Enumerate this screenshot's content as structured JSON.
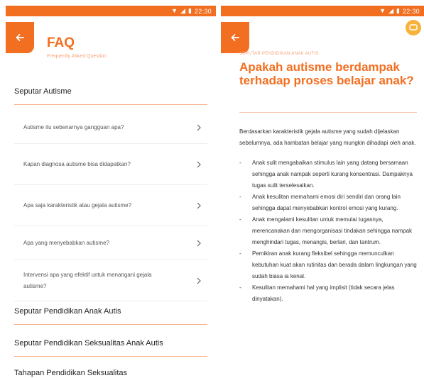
{
  "status": {
    "time": "22:30"
  },
  "faq": {
    "title": "FAQ",
    "subtitle": "Frequently Asked Question",
    "section1": "Seputar Autisme",
    "questions": [
      "Autisme itu sebenarnya gangguan apa?",
      "Kapan diagnosa autisme bisa didapatkan?",
      "Apa saja karakteristik atau gejala autisme?",
      "Apa yang menyebabkan autisme?",
      "Intervensi apa yang efektif untuk menangani gejala autisme?"
    ],
    "section2": "Seputar Pendidikan Anak Autis",
    "section3": "Seputar Pendidikan Seksualitas Anak Autis",
    "section4": "Tahapan Pendidikan Seksualitas"
  },
  "article": {
    "breadcrumb": "SEPUTAR PENDIDIKAN ANAK AUTIS",
    "title": "Apakah autisme berdampak terhadap proses belajar anak?",
    "intro": "Berdasarkan karakteristik gejala autisme yang sudah dijelaskan sebelumnya, ada hambatan belajar yang mungkin dihadapi oleh anak.",
    "bullets": [
      "Anak sulit mengabaikan stimulus lain yang datang bersamaan sehingga anak nampak seperti kurang konsentrasi. Dampaknya tugas sulit terselesaikan.",
      "Anak kesulitan memahami emosi diri sendiri dan orang lain sehingga dapat menyebabkan kontrol emosi yang kurang.",
      "Anak mengalami kesulitan untuk memulai tugasnya, merencanakan dan mengorganisasi tindakan sehingga nampak menghindari tugas, menangis, berlari, dan tantrum.",
      "Pemikiran anak kurang fleksibel sehingga memunculkan kebutuhan kuat akan rutinitas dan berada dalam lingkungan yang sudah biasa ia kenal.",
      "Kesulitan memahami hal yang implisit (tidak secara jelas dinyatakan)."
    ]
  }
}
